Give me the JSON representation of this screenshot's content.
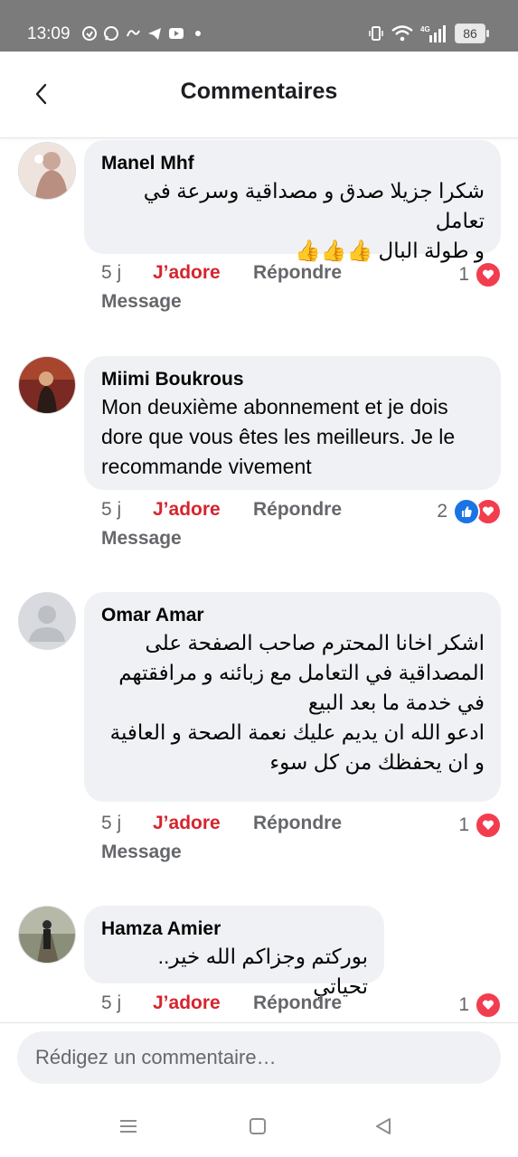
{
  "status_bar": {
    "time": "13:09",
    "icons_left": [
      "sync-icon",
      "whatsapp-icon",
      "swirl-icon",
      "telegram-icon",
      "youtube-icon",
      "dot-icon"
    ],
    "icons_right": [
      "vibrate-icon",
      "wifi-icon",
      "4g-signal-icon"
    ],
    "battery": "86"
  },
  "header": {
    "title": "Commentaires",
    "back_icon": "chevron-left-icon"
  },
  "comments": [
    {
      "author": "Manel Mhf",
      "text": "شكرا جزيلا صدق و مصداقية وسرعة في تعامل\nو طولة البال 👍👍👍",
      "time": "5 j",
      "like": "J’adore",
      "reply": "Répondre",
      "message": "Message",
      "reaction_count": "1",
      "reactions": [
        "heart"
      ]
    },
    {
      "author": "Miimi Boukrous",
      "text": "Mon deuxième abonnement et je dois dore que vous êtes les meilleurs. Je le recommande vivement",
      "time": "5 j",
      "like": "J’adore",
      "reply": "Répondre",
      "message": "Message",
      "reaction_count": "2",
      "reactions": [
        "like",
        "heart"
      ]
    },
    {
      "author": "Omar Amar",
      "text": "اشكر اخانا المحترم صاحب الصفحة على المصداقية في التعامل مع زبائنه و مرافقتهم في خدمة ما بعد البيع\nادعو الله ان يديم عليك نعمة الصحة و العافية و ان يحفظك من كل سوء",
      "time": "5 j",
      "like": "J’adore",
      "reply": "Répondre",
      "message": "Message",
      "reaction_count": "1",
      "reactions": [
        "heart"
      ]
    },
    {
      "author": "Hamza Amier",
      "text": "بوركتم وجزاكم الله خير.. تحياتي",
      "time": "5 j",
      "like": "J’adore",
      "reply": "Répondre",
      "reaction_count": "1",
      "reactions": [
        "heart"
      ]
    }
  ],
  "composer": {
    "placeholder": "Rédigez un commentaire…"
  },
  "nav_bar": {
    "icons": [
      "menu-icon",
      "home-square-icon",
      "back-triangle-icon"
    ]
  },
  "colors": {
    "like_red": "#d6242e",
    "heart_red": "#f23d4f",
    "like_blue": "#1b74e4",
    "bubble_bg": "#f0f1f4",
    "status_bar_bg": "#7b7b7b"
  }
}
